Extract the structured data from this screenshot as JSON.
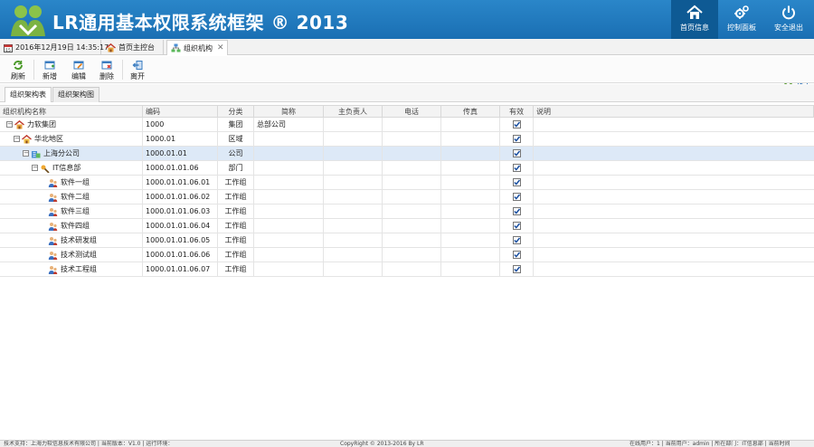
{
  "header": {
    "title": "LR通用基本权限系统框架 ® 2013",
    "nav": [
      {
        "label": "首页信息",
        "icon": "home-icon"
      },
      {
        "label": "控制面板",
        "icon": "gears-icon"
      },
      {
        "label": "安全退出",
        "icon": "power-icon"
      }
    ]
  },
  "tabs": {
    "date": "2016年12月19日 14:35:17",
    "home": "首页主控台",
    "org": "组织机构",
    "close_glyph": "✕"
  },
  "toolbar": {
    "refresh": "刷新",
    "add": "新增",
    "edit": "编辑",
    "delete": "删除",
    "leave": "离开"
  },
  "subtabs": {
    "list": "组织架构表",
    "chart": "组织架构图"
  },
  "grid": {
    "headers": {
      "name": "组织机构名称",
      "code": "编码",
      "category": "分类",
      "short": "简称",
      "leader": "主负责人",
      "phone": "电话",
      "fax": "传真",
      "valid": "有效",
      "desc": "说明"
    },
    "rows": [
      {
        "name": "力软集团",
        "code": "1000",
        "category": "集团",
        "short": "总部公司",
        "valid": true,
        "level": 0,
        "icon": "group-home-icon"
      },
      {
        "name": "华北地区",
        "code": "1000.01",
        "category": "区域",
        "short": "",
        "valid": true,
        "level": 1,
        "icon": "region-home-icon"
      },
      {
        "name": "上海分公司",
        "code": "1000.01.01",
        "category": "公司",
        "short": "",
        "valid": true,
        "level": 2,
        "icon": "company-icon"
      },
      {
        "name": "IT信息部",
        "code": "1000.01.01.06",
        "category": "部门",
        "short": "",
        "valid": true,
        "level": 3,
        "icon": "department-icon"
      },
      {
        "name": "软件一组",
        "code": "1000.01.01.06.01",
        "category": "工作组",
        "short": "",
        "valid": true,
        "level": 4,
        "icon": "workgroup-icon"
      },
      {
        "name": "软件二组",
        "code": "1000.01.01.06.02",
        "category": "工作组",
        "short": "",
        "valid": true,
        "level": 4,
        "icon": "workgroup-icon"
      },
      {
        "name": "软件三组",
        "code": "1000.01.01.06.03",
        "category": "工作组",
        "short": "",
        "valid": true,
        "level": 4,
        "icon": "workgroup-icon"
      },
      {
        "name": "软件四组",
        "code": "1000.01.01.06.04",
        "category": "工作组",
        "short": "",
        "valid": true,
        "level": 4,
        "icon": "workgroup-icon"
      },
      {
        "name": "技术研发组",
        "code": "1000.01.01.06.05",
        "category": "工作组",
        "short": "",
        "valid": true,
        "level": 4,
        "icon": "workgroup-icon"
      },
      {
        "name": "技术测试组",
        "code": "1000.01.01.06.06",
        "category": "工作组",
        "short": "",
        "valid": true,
        "level": 4,
        "icon": "workgroup-icon"
      },
      {
        "name": "技术工程组",
        "code": "1000.01.01.06.07",
        "category": "工作组",
        "short": "",
        "valid": true,
        "level": 4,
        "icon": "workgroup-icon"
      }
    ]
  },
  "footer": {
    "left": "技术支持：上海力软信息技术有限公司 | 当前版本：V1.0 | 运行环境：",
    "center": "CopyRight © 2013-2016 By LR",
    "right": "在线用户：1 | 当前用户：admin | 所在部门：IT信息部 | 当前时间"
  },
  "colors": {
    "header_bg": "#1a6fb3",
    "selected_row": "#dde9f7",
    "check": "#1a4fa0"
  }
}
